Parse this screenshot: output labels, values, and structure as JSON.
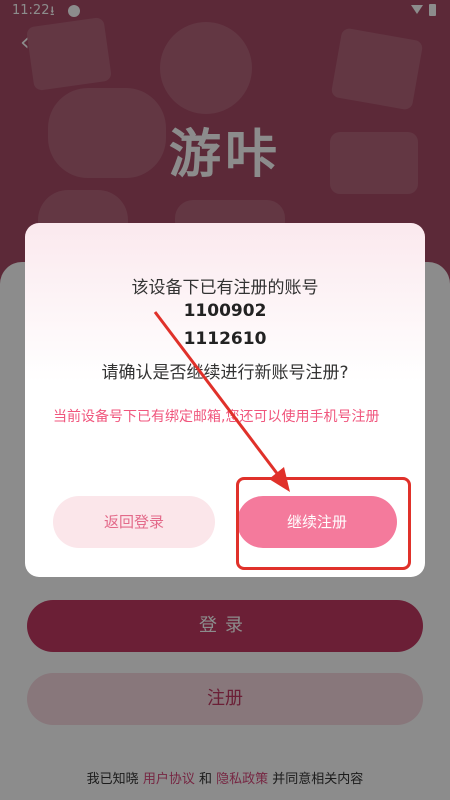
{
  "status_bar": {
    "time": "11:22",
    "download_icon": "download-icon",
    "wifi_icon": "wifi-icon",
    "battery_icon": "battery-icon"
  },
  "header": {
    "app_title": "游咔",
    "back_icon": "back-arrow-icon"
  },
  "page": {
    "login_label": "登录",
    "register_label": "注册",
    "agreement": {
      "prefix": "我已知晓",
      "user_agreement": "用户协议",
      "and": "和",
      "privacy_policy": "隐私政策",
      "suffix": "并同意相关内容"
    }
  },
  "dialog": {
    "title": "该设备下已有注册的账号",
    "accounts": [
      "1100902",
      "1112610"
    ],
    "question": "请确认是否继续进行新账号注册?",
    "note": "当前设备号下已有绑定邮箱,您还可以使用手机号注册",
    "back_to_login": "返回登录",
    "continue_register": "继续注册"
  },
  "colors": {
    "header_bg": "#a84b66",
    "accent": "#f47a9c",
    "note_text": "#f0567d",
    "annotation": "#e0312a"
  }
}
